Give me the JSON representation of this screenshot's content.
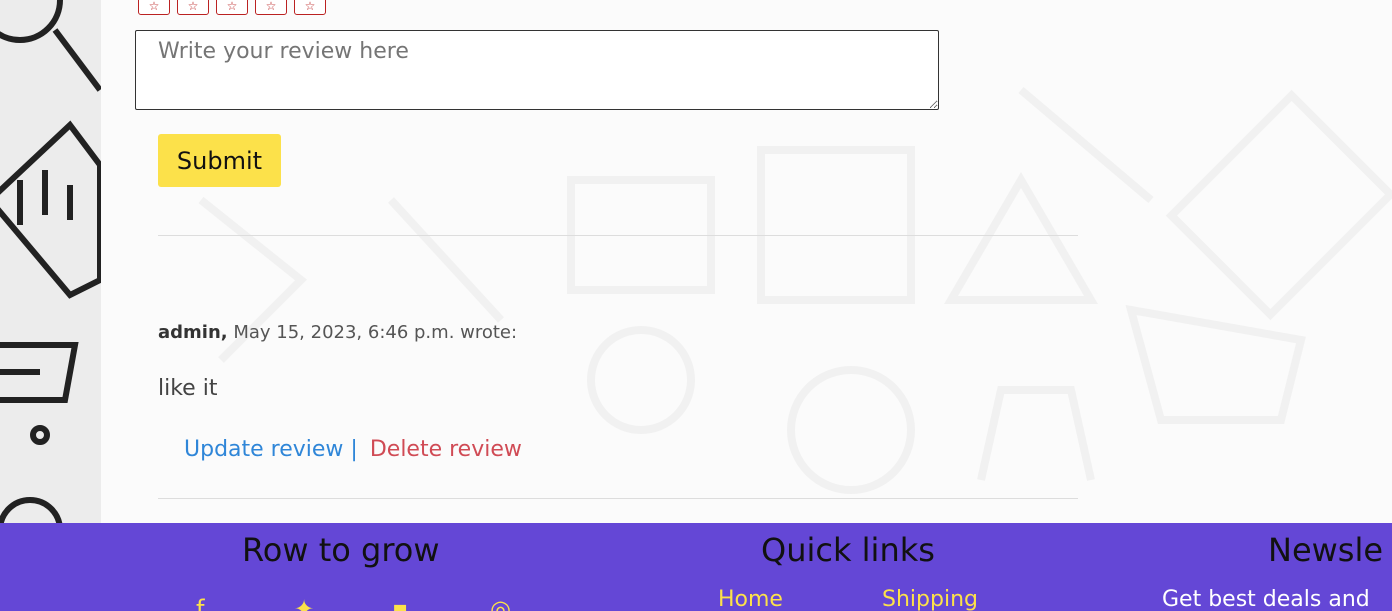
{
  "review_form": {
    "stars": [
      "star-1",
      "star-2",
      "star-3",
      "star-4",
      "star-5"
    ],
    "textarea_placeholder": "Write your review here",
    "submit_label": "Submit"
  },
  "review": {
    "author": "admin,",
    "meta": " May 15, 2023, 6:46 p.m. wrote:",
    "text": "like it",
    "update_label": "Update review |",
    "delete_label": "Delete review"
  },
  "footer": {
    "brand_title": "Row to grow",
    "quick_links_title": "Quick links",
    "newsletter_title": "Newsle",
    "links": [
      "Home",
      "Shipping"
    ],
    "newsletter_text": "Get best deals and",
    "social_icons": [
      "facebook-icon",
      "twitter-icon",
      "linkedin-icon",
      "instagram-icon"
    ],
    "colors": {
      "footer_bg": "#6447d6",
      "accent": "#fce14a"
    }
  }
}
